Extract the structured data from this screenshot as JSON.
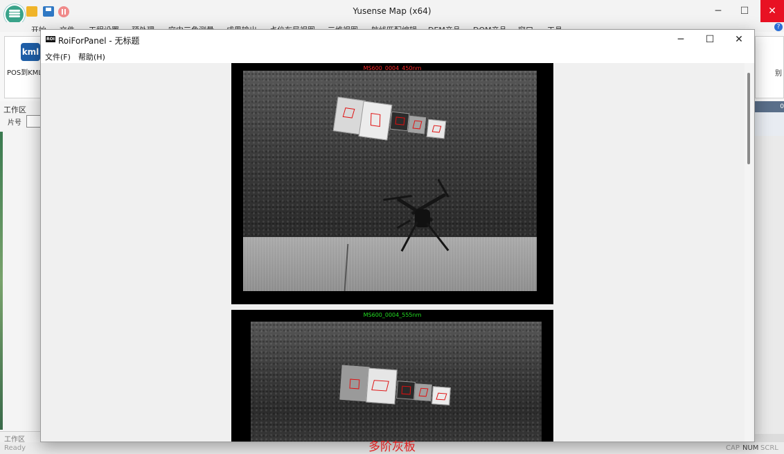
{
  "app": {
    "title": "Yusense Map (x64)",
    "menu": [
      "开始",
      "文件",
      "工程设置",
      "预处理",
      "空中三角测量",
      "成果输出",
      "点位布局视图",
      "三维视图",
      "航线匹配编辑",
      "DEM产品",
      "DOM产品",
      "窗口",
      "工具"
    ],
    "ribbon": {
      "kml_label": "kml",
      "pos_label": "POS到KML",
      "right_label": "别"
    },
    "work_panel": {
      "title": "工作区",
      "column": "片号"
    },
    "bottom_tab": "工作区",
    "status": {
      "ready": "Ready",
      "cap": "CAP",
      "num": "NUM",
      "scrl": "SCRL"
    },
    "right_panel_value": "0"
  },
  "dialog": {
    "title": "RoiForPanel - 无标题",
    "icon_text": "ROI",
    "menu": {
      "file": "文件(F)",
      "help": "帮助(H)"
    },
    "panels": [
      {
        "label": "MS600_0004_450nm",
        "label_color": "#ff2a2a"
      },
      {
        "label": "MS600_0004_555nm",
        "label_color": "#22dd22"
      }
    ]
  },
  "caption": "多阶灰板",
  "colors": {
    "roi": "#e01010",
    "close_red": "#e81123",
    "caption": "#e02020"
  }
}
